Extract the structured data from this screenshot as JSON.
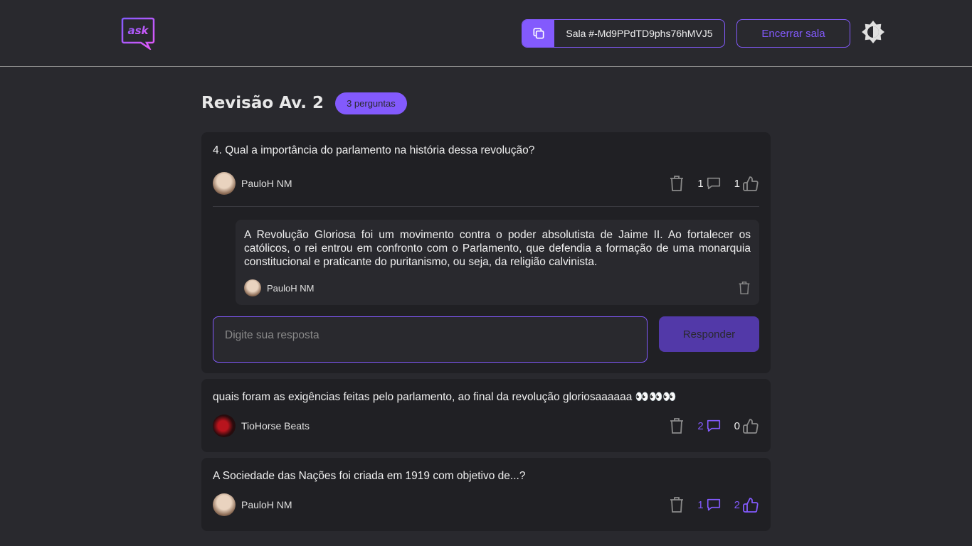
{
  "header": {
    "logo_text": "ask",
    "room_code": "Sala #-Md9PPdTD9phs76hMVJ5",
    "close_room_label": "Encerrar sala"
  },
  "room": {
    "title": "Revisão Av. 2",
    "question_count": "3 perguntas"
  },
  "colors": {
    "background": "#29292e",
    "card": "#202024",
    "accent": "#835afd"
  },
  "questions": [
    {
      "text": "4. Qual a importância do parlamento na história dessa revolução?",
      "author": "PauloH NM",
      "answers_count": "1",
      "likes_count": "1",
      "answer": {
        "text": "A Revolução Gloriosa foi um movimento contra o poder absolutista de Jaime II. Ao fortalecer os católicos, o rei entrou em confronto com o Parlamento, que defendia a formação de uma monarquia constitucional e praticante do puritanismo, ou seja, da religião calvinista.",
        "author": "PauloH NM"
      },
      "reply_placeholder": "Digite sua resposta",
      "reply_button": "Responder"
    },
    {
      "text": "quais foram as exigências feitas pelo parlamento, ao final da revolução gloriosaaaaaa 👀👀👀",
      "author": "TioHorse Beats",
      "answers_count": "2",
      "likes_count": "0"
    },
    {
      "text": "A Sociedade das Nações foi criada em 1919 com objetivo de...?",
      "author": "PauloH NM",
      "answers_count": "1",
      "likes_count": "2"
    }
  ]
}
